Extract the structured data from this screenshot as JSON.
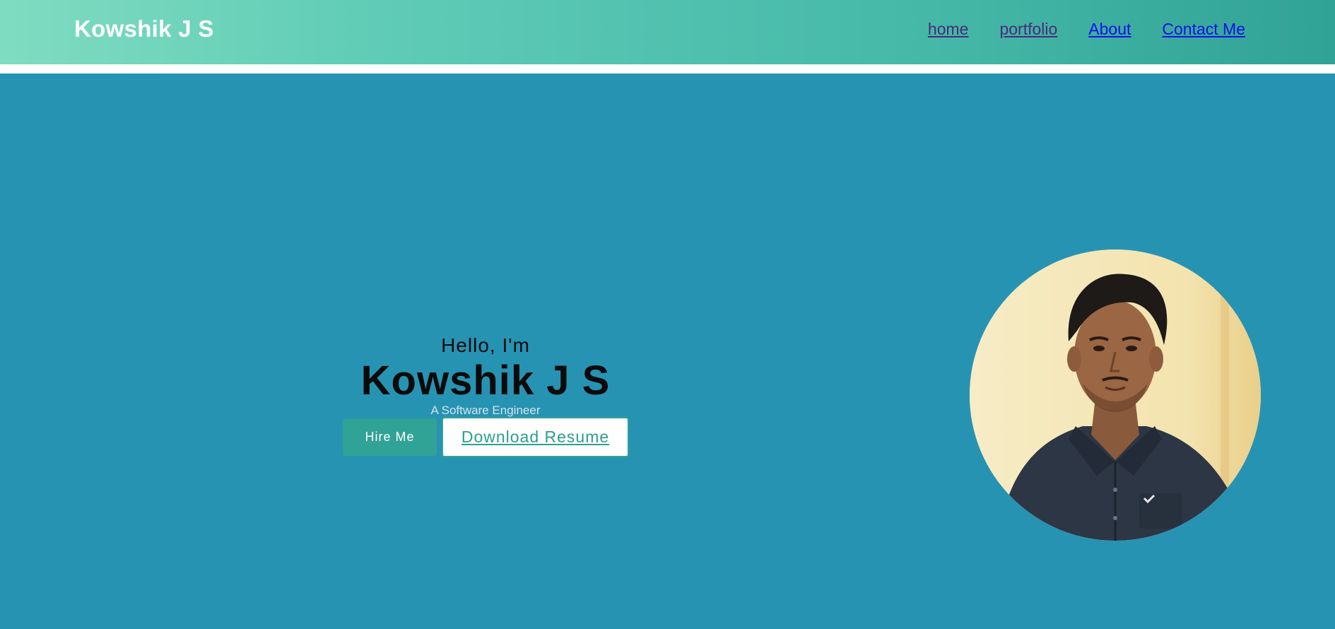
{
  "header": {
    "brand": "Kowshik J S",
    "nav": [
      {
        "label": "home",
        "state": "visited"
      },
      {
        "label": "portfolio",
        "state": "visited"
      },
      {
        "label": "About",
        "state": "unvisited"
      },
      {
        "label": "Contact Me",
        "state": "unvisited"
      }
    ]
  },
  "hero": {
    "greeting": "Hello, I'm",
    "name": "Kowshik J S",
    "role": "A Software Engineer",
    "hire_label": "Hire Me",
    "resume_label": "Download Resume",
    "portrait_alt": "profile-photo"
  },
  "colors": {
    "header_gradient_start": "#7fdcc0",
    "header_gradient_end": "#31a296",
    "hero_bg": "#2793b3",
    "accent": "#31a296",
    "visited_link": "#4a2a78",
    "link": "#0f0fe8"
  }
}
